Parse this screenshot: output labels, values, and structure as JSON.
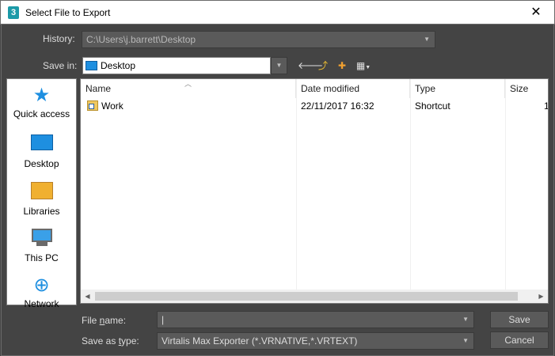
{
  "window": {
    "title": "Select File to Export",
    "app_icon": "3ds-max-icon",
    "close_glyph": "✕"
  },
  "history": {
    "label": "History:",
    "value": "C:\\Users\\j.barrett\\Desktop"
  },
  "save_in": {
    "label": "Save in:",
    "value": "Desktop"
  },
  "toolbar": {
    "back_glyph": "🡐",
    "up_glyph": "⤴",
    "new_folder_glyph": "✚",
    "view_glyph": "▦"
  },
  "places": [
    {
      "label": "Quick access",
      "icon": "star-icon",
      "glyph": "★",
      "color": "#1e8fe0"
    },
    {
      "label": "Desktop",
      "icon": "desktop-icon",
      "glyph": "▬",
      "color": "#1e8fe0"
    },
    {
      "label": "Libraries",
      "icon": "libraries-icon",
      "glyph": "▰",
      "color": "#f0b030"
    },
    {
      "label": "This PC",
      "icon": "computer-icon",
      "glyph": "🖳",
      "color": "#1e8fe0"
    },
    {
      "label": "Network",
      "icon": "network-icon",
      "glyph": "⊕",
      "color": "#1e8fe0"
    }
  ],
  "file_list": {
    "columns": [
      "Name",
      "Date modified",
      "Type",
      "Size"
    ],
    "rows": [
      {
        "name": "Work",
        "date": "22/11/2017 16:32",
        "type": "Shortcut",
        "size": "1"
      }
    ]
  },
  "file_name": {
    "label_prefix": "File ",
    "label_underline": "n",
    "label_suffix": "ame:",
    "value": ""
  },
  "save_as_type": {
    "label_prefix": "Save as ",
    "label_underline": "t",
    "label_suffix": "ype:",
    "value": "Virtalis Max Exporter (*.VRNATIVE,*.VRTEXT)"
  },
  "buttons": {
    "save": "Save",
    "cancel": "Cancel"
  }
}
